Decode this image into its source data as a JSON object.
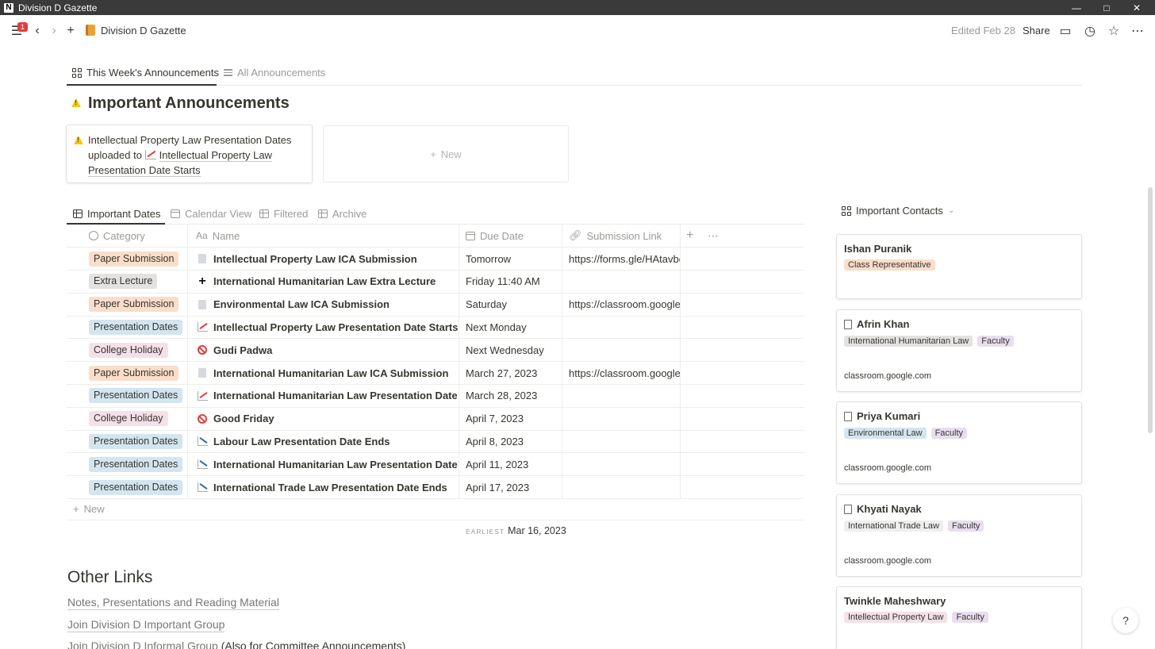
{
  "window": {
    "title": "Division D Gazette",
    "minimize": "—",
    "maximize": "□",
    "close": "✕"
  },
  "topbar": {
    "notification_count": "1",
    "page_title": "Division D Gazette",
    "edited": "Edited Feb 28",
    "share": "Share"
  },
  "view_tabs": [
    "This Week's Announcements",
    "All Announcements"
  ],
  "announcements": {
    "heading": "Important Announcements",
    "card_text_1": "Intellectual Property Law Presentation Dates uploaded to ",
    "card_link": "Intellectual Property Law Presentation Date Starts",
    "new_label": "New"
  },
  "db_tabs": [
    "Important Dates",
    "Calendar View",
    "Filtered",
    "Archive"
  ],
  "table": {
    "headers": {
      "category": "Category",
      "name": "Name",
      "due": "Due Date",
      "link": "Submission Link"
    },
    "rows": [
      {
        "category": "Paper Submission",
        "icon": "doc-icon",
        "name": "Intellectual Property Law ICA Submission",
        "due": "Tomorrow",
        "link": "https://forms.gle/HAtavbe"
      },
      {
        "category": "Extra Lecture",
        "icon": "plus-icon",
        "name": "International Humanitarian Law Extra Lecture",
        "due": "Friday 11:40 AM",
        "link": ""
      },
      {
        "category": "Paper Submission",
        "icon": "doc-icon",
        "name": "Environmental Law ICA Submission",
        "due": "Saturday",
        "link": "https://classroom.google.c"
      },
      {
        "category": "Presentation Dates",
        "icon": "chart-up-icon",
        "name": "Intellectual Property Law Presentation Date Starts",
        "due": "Next Monday",
        "link": ""
      },
      {
        "category": "College Holiday",
        "icon": "no-entry-icon",
        "name": "Gudi Padwa",
        "due": "Next Wednesday",
        "link": ""
      },
      {
        "category": "Paper Submission",
        "icon": "doc-icon",
        "name": "International Humanitarian Law ICA Submission",
        "due": "March 27, 2023",
        "link": "https://classroom.google.c"
      },
      {
        "category": "Presentation Dates",
        "icon": "chart-up-icon",
        "name": "International Humanitarian Law Presentation Date Starts",
        "due": "March 28, 2023",
        "link": ""
      },
      {
        "category": "College Holiday",
        "icon": "no-entry-icon",
        "name": "Good Friday",
        "due": "April 7, 2023",
        "link": ""
      },
      {
        "category": "Presentation Dates",
        "icon": "chart-down-icon",
        "name": "Labour Law Presentation Date Ends",
        "due": "April 8, 2023",
        "link": ""
      },
      {
        "category": "Presentation Dates",
        "icon": "chart-down-icon",
        "name": "International Humanitarian Law Presentation Date Ends",
        "due": "April 11, 2023",
        "link": ""
      },
      {
        "category": "Presentation Dates",
        "icon": "chart-down-icon",
        "name": "International Trade Law Presentation Date Ends",
        "due": "April 17, 2023",
        "link": ""
      }
    ],
    "new_label": "New",
    "earliest_label": "EARLIEST",
    "earliest_value": "Mar 16, 2023"
  },
  "category_colors": {
    "Paper Submission": "#fadec9",
    "Extra Lecture": "#e3e2e0",
    "Presentation Dates": "#d3e5ef",
    "College Holiday": "#f5e0e9"
  },
  "other_links": {
    "heading": "Other Links",
    "items": [
      "Notes, Presentations and Reading Material",
      "Join Division D Important Group",
      "Join Division D Informal Group"
    ],
    "suffix": " (Also for Committee Announcements)"
  },
  "contacts": {
    "title": "Important Contacts",
    "cards": [
      {
        "name": "Ishan Puranik",
        "tags": [
          "Class Representative"
        ],
        "link": ""
      },
      {
        "name": "Afrin Khan",
        "tags": [
          "International Humanitarian Law",
          "Faculty"
        ],
        "link": "classroom.google.com"
      },
      {
        "name": "Priya Kumari",
        "tags": [
          "Environmental Law",
          "Faculty"
        ],
        "link": "classroom.google.com"
      },
      {
        "name": "Khyati Nayak",
        "tags": [
          "International Trade Law",
          "Faculty"
        ],
        "link": "classroom.google.com"
      },
      {
        "name": "Twinkle Maheshwary",
        "tags": [
          "Intellectual Property Law",
          "Faculty"
        ],
        "link": ""
      }
    ]
  },
  "help_label": "?"
}
